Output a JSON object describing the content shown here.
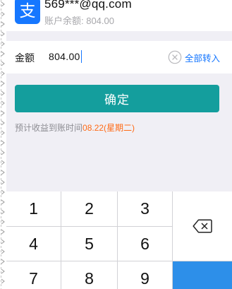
{
  "account": {
    "email": "569***@qq.com",
    "balance_label": "账户余额: 804.00",
    "logo_glyph": "支",
    "logo_icon": "alipay-logo-icon",
    "logo_color": "#1677ff"
  },
  "amount": {
    "label": "金额",
    "value": "804.00",
    "clear_icon": "clear-circle-icon",
    "transfer_all_label": "全部转入"
  },
  "confirm_label": "确定",
  "arrival": {
    "prefix": "预计收益到账时间",
    "date": "08.22(星期二)"
  },
  "keypad": {
    "keys": [
      "1",
      "2",
      "3",
      "4",
      "5",
      "6",
      "7",
      "8",
      "9"
    ],
    "delete_icon": "backspace-icon"
  },
  "colors": {
    "background": "#f0eff5",
    "accent_blue": "#1677ff",
    "confirm_button": "#149e9d",
    "date_orange": "#ff6a15",
    "keypad_confirm": "#2d8fe9"
  }
}
